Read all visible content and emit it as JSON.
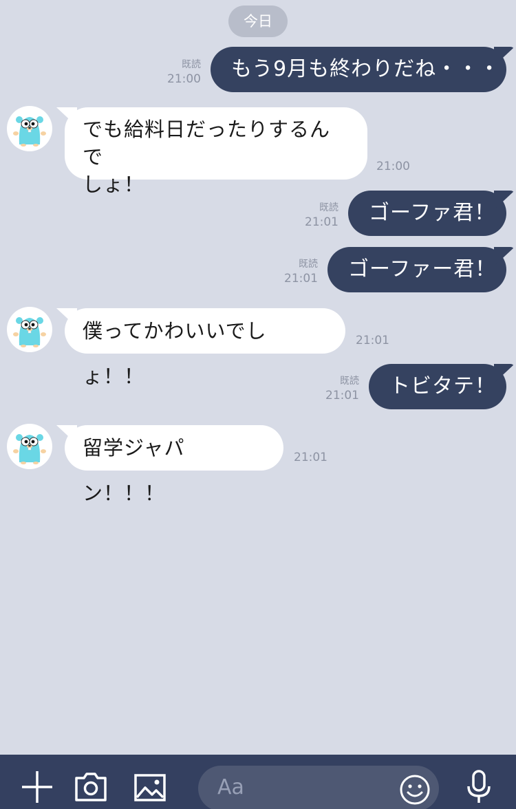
{
  "date_label": "今日",
  "messages": [
    {
      "direction": "out",
      "text": "もう9月も終わりだね・・・",
      "read": "既読",
      "time": "21:00"
    },
    {
      "direction": "in",
      "line1": "でも給料日だったりするんで",
      "line2": "しょ！",
      "time": "21:00"
    },
    {
      "direction": "out",
      "text": "ゴーファ君！",
      "read": "既読",
      "time": "21:01"
    },
    {
      "direction": "out",
      "text": "ゴーファー君！",
      "read": "既読",
      "time": "21:01"
    },
    {
      "direction": "in",
      "text": "僕ってかわいいでしょ！！",
      "time": "21:01"
    },
    {
      "direction": "out",
      "text": "トビタテ！",
      "read": "既読",
      "time": "21:01"
    },
    {
      "direction": "in",
      "text": "留学ジャパン！！！",
      "time": "21:01"
    }
  ],
  "input": {
    "placeholder": "Aa"
  },
  "icons": {
    "add": "plus-icon",
    "camera": "camera-icon",
    "image": "image-icon",
    "emoji": "smiley-icon",
    "mic": "microphone-icon"
  },
  "colors": {
    "background": "#d7dbe6",
    "outgoing_bubble": "#354260",
    "incoming_bubble": "#ffffff",
    "bottom_bar": "#344060",
    "gopher": "#6ad7e5"
  }
}
